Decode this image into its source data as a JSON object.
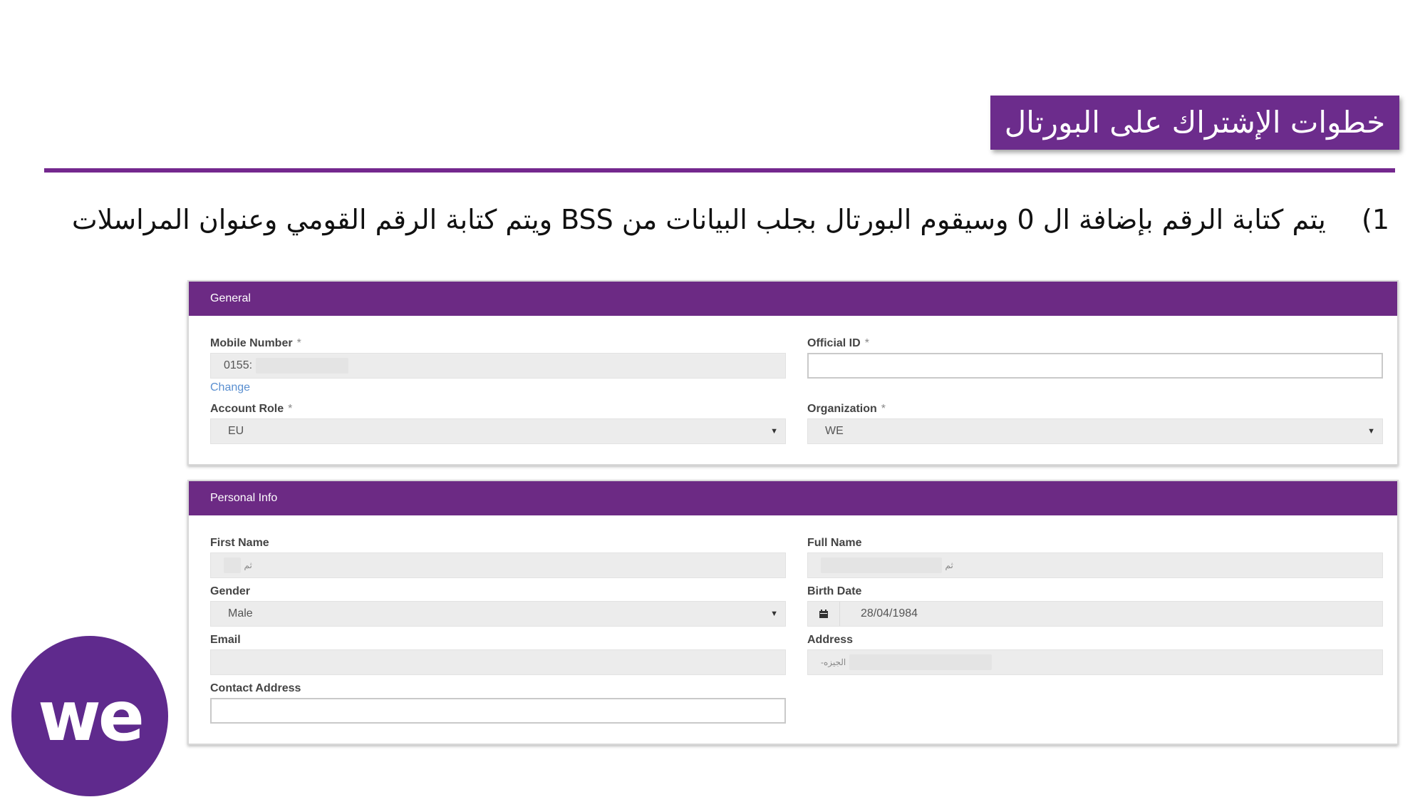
{
  "slide": {
    "title": "خطوات الإشتراك على البورتال",
    "step_number": "1)",
    "instruction": "يتم كتابة الرقم بإضافة ال 0 وسيقوم البورتال بجلب البيانات من BSS ويتم كتابة الرقم القومي وعنوان المراسلات"
  },
  "general": {
    "header": "General",
    "mobile_label": "Mobile Number",
    "mobile_value": "0155:",
    "change_link": "Change",
    "official_id_label": "Official ID",
    "official_id_value": "",
    "account_role_label": "Account Role",
    "account_role_value": "EU",
    "organization_label": "Organization",
    "organization_value": "WE",
    "required_mark": "*"
  },
  "personal": {
    "header": "Personal Info",
    "first_name_label": "First Name",
    "first_name_value": "ثم",
    "full_name_label": "Full Name",
    "full_name_value": "ثم",
    "gender_label": "Gender",
    "gender_value": "Male",
    "birth_date_label": "Birth Date",
    "birth_date_value": "28/04/1984",
    "email_label": "Email",
    "email_value": "",
    "address_label": "Address",
    "address_value": "-الجيزه",
    "contact_address_label": "Contact Address",
    "contact_address_value": ""
  },
  "logo": {
    "text": "we",
    "color": "#5f2a8d"
  },
  "colors": {
    "brand_purple": "#6c2a84",
    "rule": "#74288e"
  },
  "icons": {
    "dropdown": "caret-down-icon",
    "calendar": "calendar-icon"
  }
}
